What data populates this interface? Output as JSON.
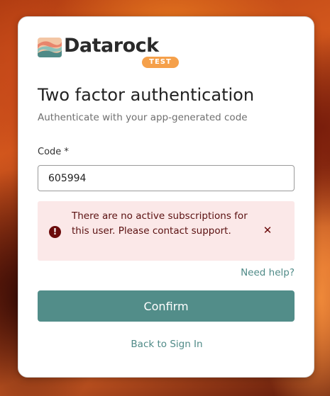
{
  "brand": {
    "name": "Datarock",
    "badge": "TEST",
    "logo_icon": "datarock-logo-icon",
    "badge_color": "#f5a04a"
  },
  "page": {
    "title": "Two factor authentication",
    "subtitle": "Authenticate with your app-generated code"
  },
  "form": {
    "code_label": "Code *",
    "code_value": "605994"
  },
  "alert": {
    "icon": "error-icon",
    "message": "There are no active subscriptions for this user. Please contact support.",
    "close_icon": "close-icon",
    "background": "#fbe8e8",
    "text_color": "#5a1010"
  },
  "links": {
    "need_help": "Need help?",
    "back": "Back to Sign In"
  },
  "actions": {
    "confirm_label": "Confirm",
    "accent_color": "#528d89"
  }
}
